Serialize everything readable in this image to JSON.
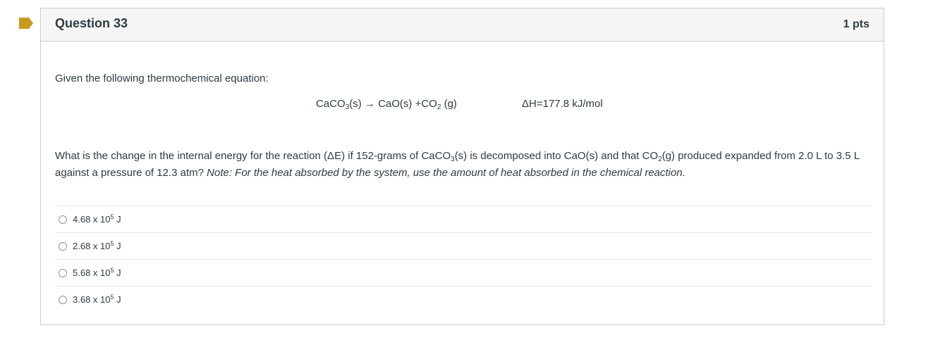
{
  "question": {
    "title": "Question 33",
    "points": "1 pts",
    "flag_color": "#c89a1e",
    "intro": "Given the following thermochemical equation:",
    "equation": {
      "part1": "CaCO",
      "sub1": "3",
      "part2": "(s) → CaO(s) +CO",
      "sub2": "2",
      "part3": " (g)"
    },
    "enthalpy": "ΔH=177.8 kJ/mol",
    "prompt": {
      "t1": "What is the change in the internal energy for the reaction (ΔE) if 152-grams of CaCO",
      "s1": "3",
      "t2": "(s) is decomposed into CaO(s) and that CO",
      "s2": "2",
      "t3": "(g) produced expanded from 2.0 L to 3.5 L against a pressure of 12.3 atm? ",
      "note": "Note: For the heat absorbed by the system, use the amount of heat absorbed in the chemical reaction."
    },
    "answers": [
      {
        "mantissa": "4.68 x 10",
        "exp": "5",
        "unit": " J"
      },
      {
        "mantissa": "2.68 x 10",
        "exp": "5",
        "unit": " J"
      },
      {
        "mantissa": "5.68 x 10",
        "exp": "5",
        "unit": " J"
      },
      {
        "mantissa": "3.68 x 10",
        "exp": "5",
        "unit": " J"
      }
    ]
  }
}
